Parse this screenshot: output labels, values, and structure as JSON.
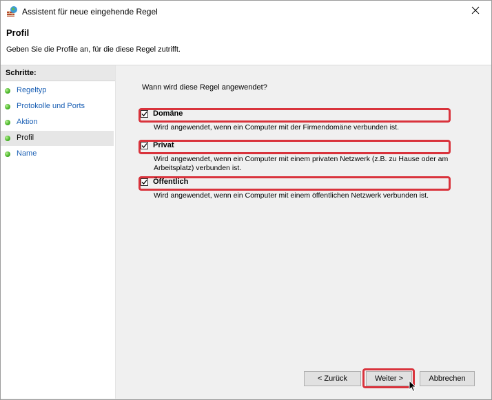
{
  "window": {
    "title": "Assistent für neue eingehende Regel",
    "icon": "firewall-globe-icon",
    "close_icon": "close-icon"
  },
  "header": {
    "title": "Profil",
    "subtitle": "Geben Sie die Profile an, für die diese Regel zutrifft."
  },
  "steps": {
    "heading": "Schritte:",
    "items": [
      {
        "label": "Regeltyp",
        "active": false
      },
      {
        "label": "Protokolle und Ports",
        "active": false
      },
      {
        "label": "Aktion",
        "active": false
      },
      {
        "label": "Profil",
        "active": true
      },
      {
        "label": "Name",
        "active": false
      }
    ]
  },
  "content": {
    "question": "Wann wird diese Regel angewendet?",
    "options": [
      {
        "label": "Domäne",
        "checked": true,
        "description": "Wird angewendet, wenn ein Computer mit der Firmendomäne verbunden ist."
      },
      {
        "label": "Privat",
        "checked": true,
        "description": "Wird angewendet, wenn ein Computer mit einem privaten Netzwerk (z.B. zu Hause oder am Arbeitsplatz) verbunden ist."
      },
      {
        "label": "Öffentlich",
        "checked": true,
        "description": "Wird angewendet, wenn ein Computer mit einem öffentlichen Netzwerk verbunden ist."
      }
    ]
  },
  "buttons": {
    "back": "< Zurück",
    "next": "Weiter >",
    "cancel": "Abbrechen"
  },
  "colors": {
    "highlight": "#d9333c",
    "link": "#1a5fb4",
    "step_bullet": "#4cb82a"
  }
}
